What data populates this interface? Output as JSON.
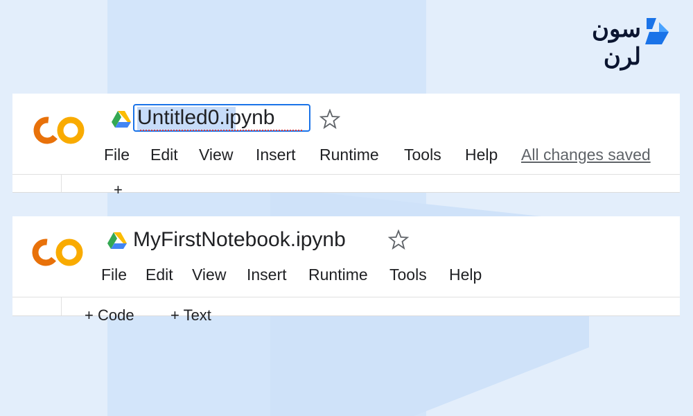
{
  "brand": {
    "name": "سون لرن",
    "accent": "#1a73e8"
  },
  "top": {
    "title": "Untitled0.ipynb",
    "menu": [
      "File",
      "Edit",
      "View",
      "Insert",
      "Runtime",
      "Tools",
      "Help"
    ],
    "save_status": "All changes saved",
    "toolbar_partial": "+"
  },
  "bottom": {
    "title": "MyFirstNotebook.ipynb",
    "menu": [
      "File",
      "Edit",
      "View",
      "Insert",
      "Runtime",
      "Tools",
      "Help"
    ],
    "toolbar": {
      "code": "+ Code",
      "text": "+ Text"
    }
  },
  "icons": [
    "colab-logo-icon",
    "google-drive-icon",
    "star-icon"
  ],
  "colors": {
    "colab_orange": "#f9ab00",
    "colab_dark_orange": "#e8710a",
    "background": "#e3eefb",
    "selection": "#c7dcf9"
  }
}
